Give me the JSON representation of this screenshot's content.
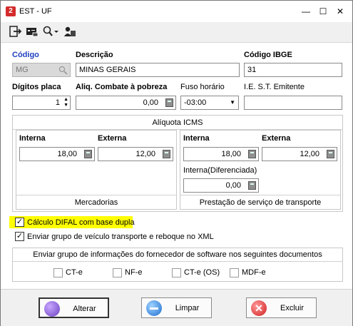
{
  "window": {
    "title": "EST - UF",
    "minimize": "—",
    "maximize": "☐",
    "close": "✕"
  },
  "toolbar": {
    "icons": [
      "exit-icon",
      "card-icon",
      "search-icon",
      "users-icon"
    ]
  },
  "form": {
    "codigo_label": "Código",
    "codigo_value": "MG",
    "descricao_label": "Descrição",
    "descricao_value": "MINAS GERAIS",
    "ibge_label": "Código IBGE",
    "ibge_value": "31",
    "digitos_label": "Dígitos placa",
    "digitos_value": "1",
    "aliq_pobreza_label": "Aliq. Combate à pobreza",
    "aliq_pobreza_value": "0,00",
    "fuso_label": "Fuso horário",
    "fuso_value": "-03:00",
    "iest_label": "I.E. S.T.  Emitente",
    "iest_value": ""
  },
  "icms": {
    "title": "Alíquota ICMS",
    "mercadorias": {
      "interna_label": "Interna",
      "interna_value": "18,00",
      "externa_label": "Externa",
      "externa_value": "12,00",
      "footer": "Mercadorias"
    },
    "transporte": {
      "interna_label": "Interna",
      "interna_value": "18,00",
      "externa_label": "Externa",
      "externa_value": "12,00",
      "diferenciada_label": "Interna(Diferenciada)",
      "diferenciada_value": "0,00",
      "footer": "Prestação de serviço de transporte"
    }
  },
  "options": {
    "difal": {
      "label": "Cálculo DIFAL com base dupla",
      "checked": true
    },
    "veiculo": {
      "label": "Enviar grupo de veículo transporte e reboque no XML",
      "checked": true
    }
  },
  "fornecedor": {
    "title": "Enviar grupo de informações do fornecedor de software nos seguintes documentos",
    "docs": [
      {
        "label": "CT-e",
        "checked": false
      },
      {
        "label": "NF-e",
        "checked": false
      },
      {
        "label": "CT-e (OS)",
        "checked": false
      },
      {
        "label": "MDF-e",
        "checked": false
      }
    ]
  },
  "buttons": {
    "alterar": "Alterar",
    "limpar": "Limpar",
    "excluir": "Excluir"
  },
  "colors": {
    "highlight": "#ffff00",
    "label_blue": "#1f3fbf"
  }
}
